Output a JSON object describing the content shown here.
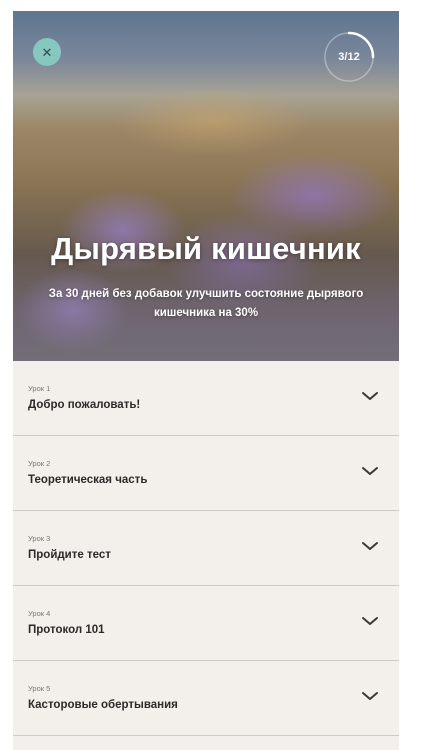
{
  "header": {
    "close_icon": "close-icon",
    "progress_text": "3/12",
    "progress_fraction": 0.25,
    "title": "Дырявый кишечник",
    "subtitle": "За 30 дней без добавок улучшить состояние дырявого кишечника на 30%"
  },
  "lessons": [
    {
      "number": "Урок 1",
      "title": "Добро пожаловать!"
    },
    {
      "number": "Урок 2",
      "title": "Теоретическая часть"
    },
    {
      "number": "Урок 3",
      "title": "Пройдите тест"
    },
    {
      "number": "Урок 4",
      "title": "Протокол 101"
    },
    {
      "number": "Урок 5",
      "title": "Касторовые обертывания"
    }
  ],
  "colors": {
    "close_button": "#86c7c0",
    "background": "#f3f0ec",
    "divider": "#cfcac4"
  }
}
